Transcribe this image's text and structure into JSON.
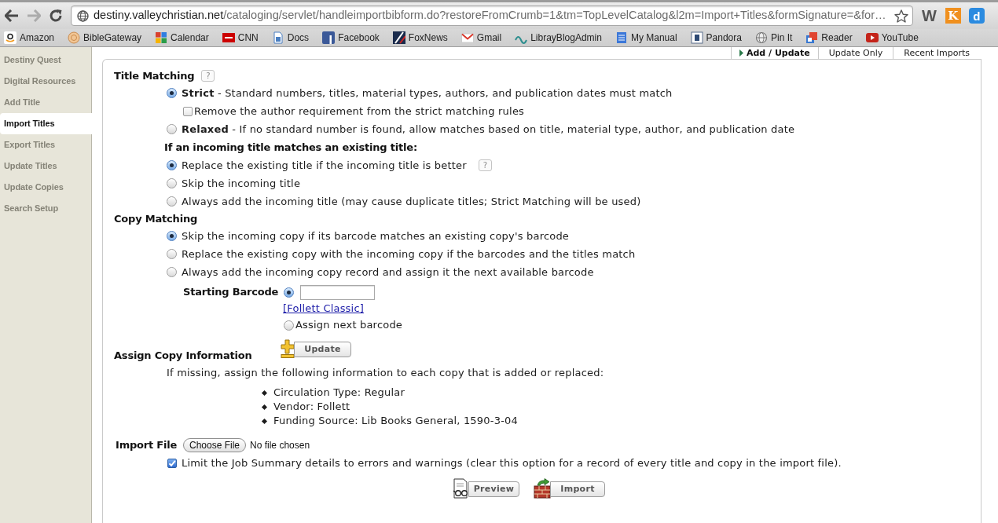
{
  "browser": {
    "url_host": "destiny.valleychristian.net",
    "url_path": "/cataloging/servlet/handleimportbibform.do?restoreFromCrumb=1&tm=TopLevelCatalog&l2m=Import+Titles&formSignature=&for…",
    "forward_disabled": true,
    "extensions": [
      "W",
      "K",
      "d"
    ]
  },
  "bookmarks": [
    "Amazon",
    "BibleGateway",
    "Calendar",
    "CNN",
    "Docs",
    "Facebook",
    "FoxNews",
    "Gmail",
    "LibrayBlogAdmin",
    "My Manual",
    "Pandora",
    "Pin It",
    "Reader",
    "YouTube"
  ],
  "sidebar": {
    "items": [
      {
        "label": "Destiny Quest",
        "selected": false
      },
      {
        "label": "Digital Resources",
        "selected": false
      },
      {
        "label": "Add Title",
        "selected": false
      },
      {
        "label": "Import Titles",
        "selected": true
      },
      {
        "label": "Export Titles",
        "selected": false
      },
      {
        "label": "Update Titles",
        "selected": false
      },
      {
        "label": "Update Copies",
        "selected": false
      },
      {
        "label": "Search Setup",
        "selected": false
      }
    ]
  },
  "tabs": [
    {
      "label": "Add / Update",
      "selected": true
    },
    {
      "label": "Update Only",
      "selected": false
    },
    {
      "label": "Recent Imports",
      "selected": false
    }
  ],
  "title_matching": {
    "heading": "Title Matching",
    "help": "?",
    "options": [
      {
        "text": "**Strict** - Standard numbers, titles, material types, authors, and publication dates must match",
        "selected": true,
        "sub_option": {
          "label": "Remove the author requirement from the strict matching rules",
          "checked": false
        }
      },
      {
        "text": "**Relaxed** - If no standard number is found, allow matches based on title, material type, author, and publication date",
        "selected": false
      }
    ]
  },
  "existing_title": {
    "heading": "If an incoming title matches an existing title:",
    "options": [
      {
        "text": "Replace the existing title if the incoming title is better",
        "selected": true,
        "help": "?"
      },
      {
        "text": "Skip the incoming title",
        "selected": false
      },
      {
        "text": "Always add the incoming title (may cause duplicate titles; Strict Matching will be used)",
        "selected": false
      }
    ]
  },
  "copy_matching": {
    "heading": "Copy Matching",
    "options": [
      {
        "text": "Skip the incoming copy if its barcode matches an existing copy's barcode",
        "selected": true
      },
      {
        "text": "Replace the existing copy with the incoming copy if the barcodes and the titles match",
        "selected": false
      },
      {
        "text": "Always add the incoming copy record and assign it the next available barcode",
        "selected": false
      }
    ],
    "starting_barcode": {
      "label": "Starting Barcode",
      "options": [
        {
          "kind": "input",
          "selected": true,
          "link": "[Follett Classic]"
        },
        {
          "kind": "label",
          "label": "Assign next barcode",
          "selected": false
        }
      ]
    }
  },
  "assign_copy_information": {
    "heading": "Assign Copy Information",
    "update_button": "Update",
    "intro": "If missing, assign the following information to each copy that is added or replaced:",
    "items": [
      "Circulation Type: Regular",
      "Vendor: Follett",
      "Funding Source: Lib Books General, 1590-3-04"
    ]
  },
  "import_file": {
    "label": "Import File",
    "button": "Choose File",
    "status": "No file chosen"
  },
  "limit_summary": {
    "label": "Limit the Job Summary details to errors and warnings (clear this option for a record of every title and copy in the import file).",
    "checked": true
  },
  "actions": [
    {
      "kind": "preview",
      "label": "Preview"
    },
    {
      "kind": "import",
      "label": "Import"
    }
  ]
}
